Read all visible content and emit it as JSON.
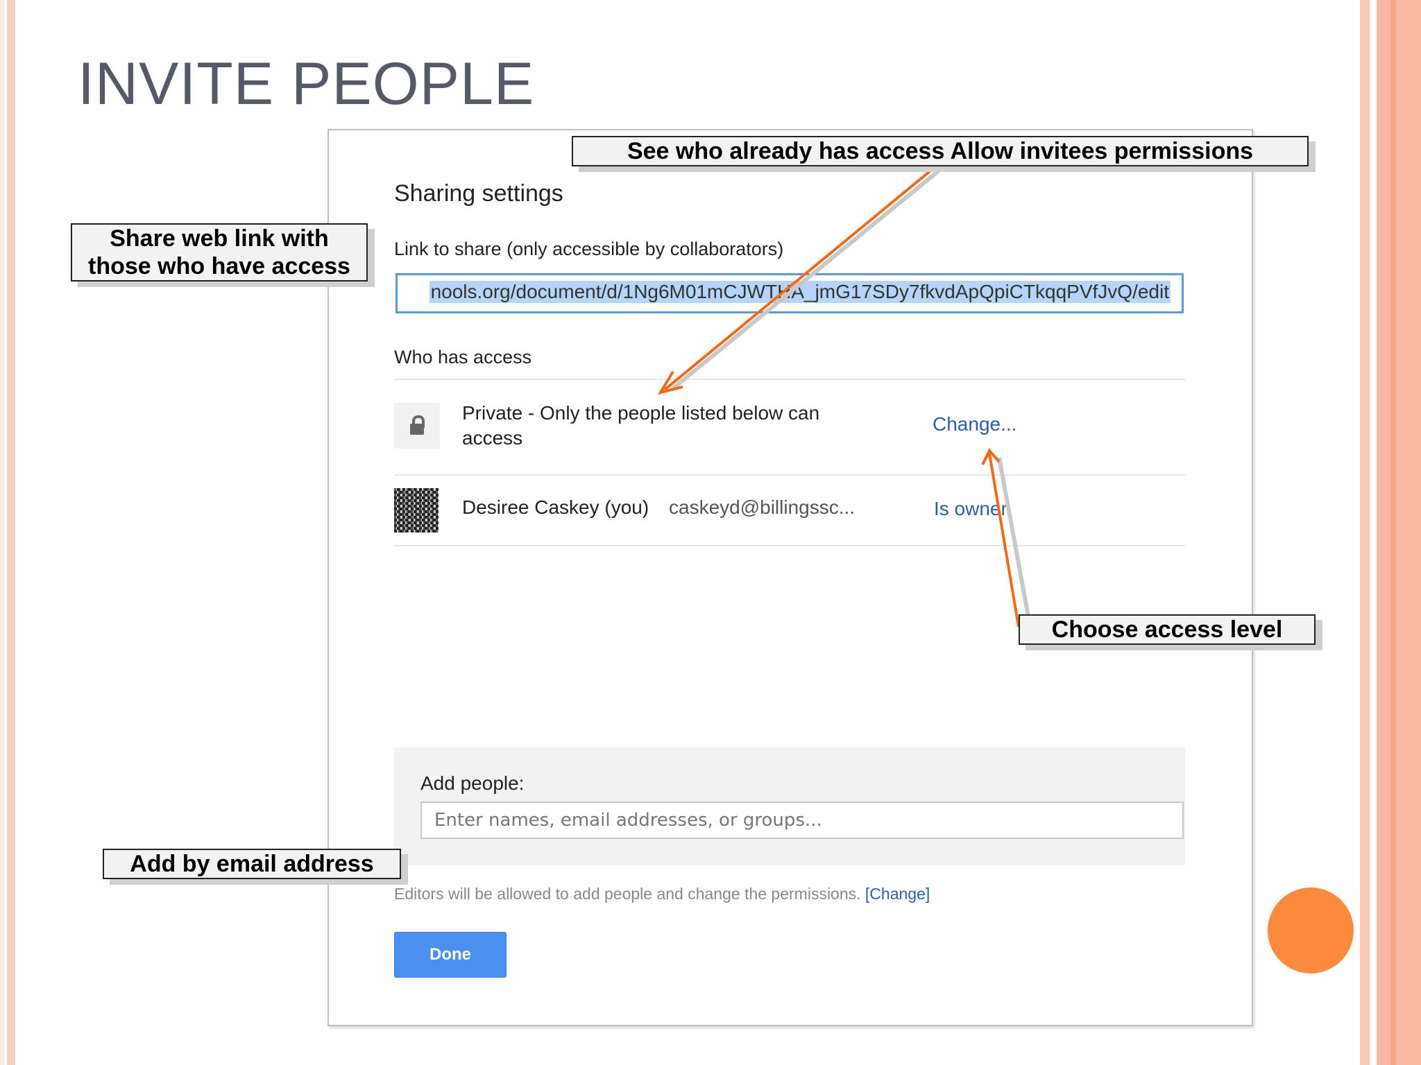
{
  "slide": {
    "title": "INVITE PEOPLE",
    "accent_color": "#f58a3c"
  },
  "dialog": {
    "heading": "Sharing settings",
    "link_label": "Link to share (only accessible by collaborators)",
    "link_value": "nools.org/document/d/1Ng6M01mCJWTHA_jmG17SDy7fkvdApQpiCTkqqPVfJvQ/edit",
    "who_label": "Who has access",
    "access": {
      "icon": "lock-icon",
      "text": "Private - Only the people listed below can access",
      "change_label": "Change..."
    },
    "owner": {
      "name": "Desiree Caskey (you)",
      "email": "caskeyd@billingssc...",
      "role": "Is owner"
    },
    "add_people": {
      "label": "Add people:",
      "placeholder": "Enter names, email addresses, or groups..."
    },
    "editors_note": "Editors will be allowed to add people and change the permissions.",
    "editors_link": "[Change]",
    "done_label": "Done"
  },
  "callouts": {
    "see_who": "See who already has access Allow invitees permissions",
    "share_link": [
      "Share web link with",
      "those who have access"
    ],
    "choose_level": "Choose access level",
    "add_email": "Add by email address"
  }
}
